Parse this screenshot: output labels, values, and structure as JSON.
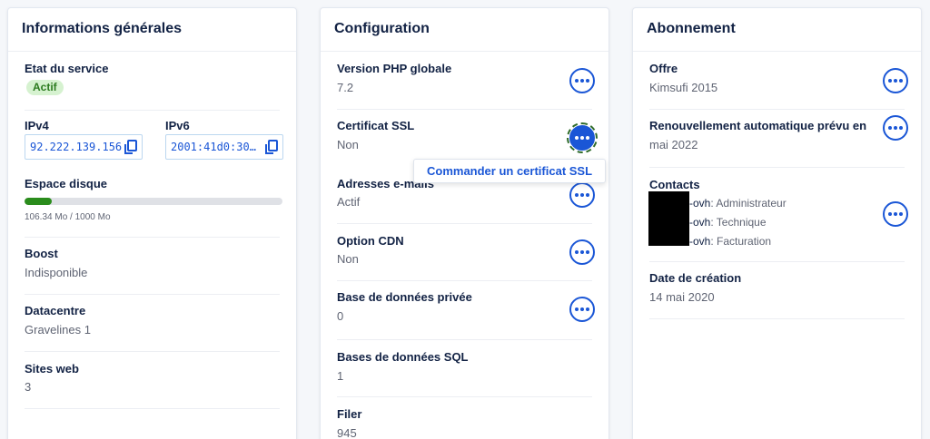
{
  "general": {
    "title": "Informations générales",
    "service_label": "Etat du service",
    "service_status": "Actif",
    "ipv4_label": "IPv4",
    "ipv4_value": "92.222.139.156",
    "ipv6_label": "IPv6",
    "ipv6_value": "2001:41d0:30…",
    "disk_label": "Espace disque",
    "disk_usage_text": "106.34 Mo / 1000 Mo",
    "disk_usage_fraction": 0.10634,
    "boost_label": "Boost",
    "boost_value": "Indisponible",
    "datacenter_label": "Datacentre",
    "datacenter_value": "Gravelines 1",
    "sites_label": "Sites web",
    "sites_value": "3"
  },
  "config": {
    "title": "Configuration",
    "php_label": "Version PHP globale",
    "php_value": "7.2",
    "ssl_label": "Certificat SSL",
    "ssl_value": "Non",
    "ssl_tooltip": "Commander un certificat SSL",
    "email_label": "Adresses e-mails",
    "email_value": "Actif",
    "cdn_label": "Option CDN",
    "cdn_value": "Non",
    "privdb_label": "Base de données privée",
    "privdb_value": "0",
    "sqldb_label": "Bases de données SQL",
    "sqldb_value": "1",
    "filer_label": "Filer",
    "filer_value": "945"
  },
  "subscription": {
    "title": "Abonnement",
    "offer_label": "Offre",
    "offer_value": "Kimsufi 2015",
    "renew_label": "Renouvellement automatique prévu en",
    "renew_value": "mai 2022",
    "contacts_label": "Contacts",
    "contacts": [
      {
        "suffix": "-ovh",
        "role": ": Administrateur"
      },
      {
        "suffix": "-ovh",
        "role": ": Technique"
      },
      {
        "suffix": "-ovh",
        "role": ": Facturation"
      }
    ],
    "created_label": "Date de création",
    "created_value": "14 mai 2020"
  },
  "colors": {
    "accent": "#1a56d6",
    "title": "#122244",
    "success_bg": "#d6f2d0",
    "success_text": "#2b7a1e",
    "progress": "#2a8c1c"
  }
}
